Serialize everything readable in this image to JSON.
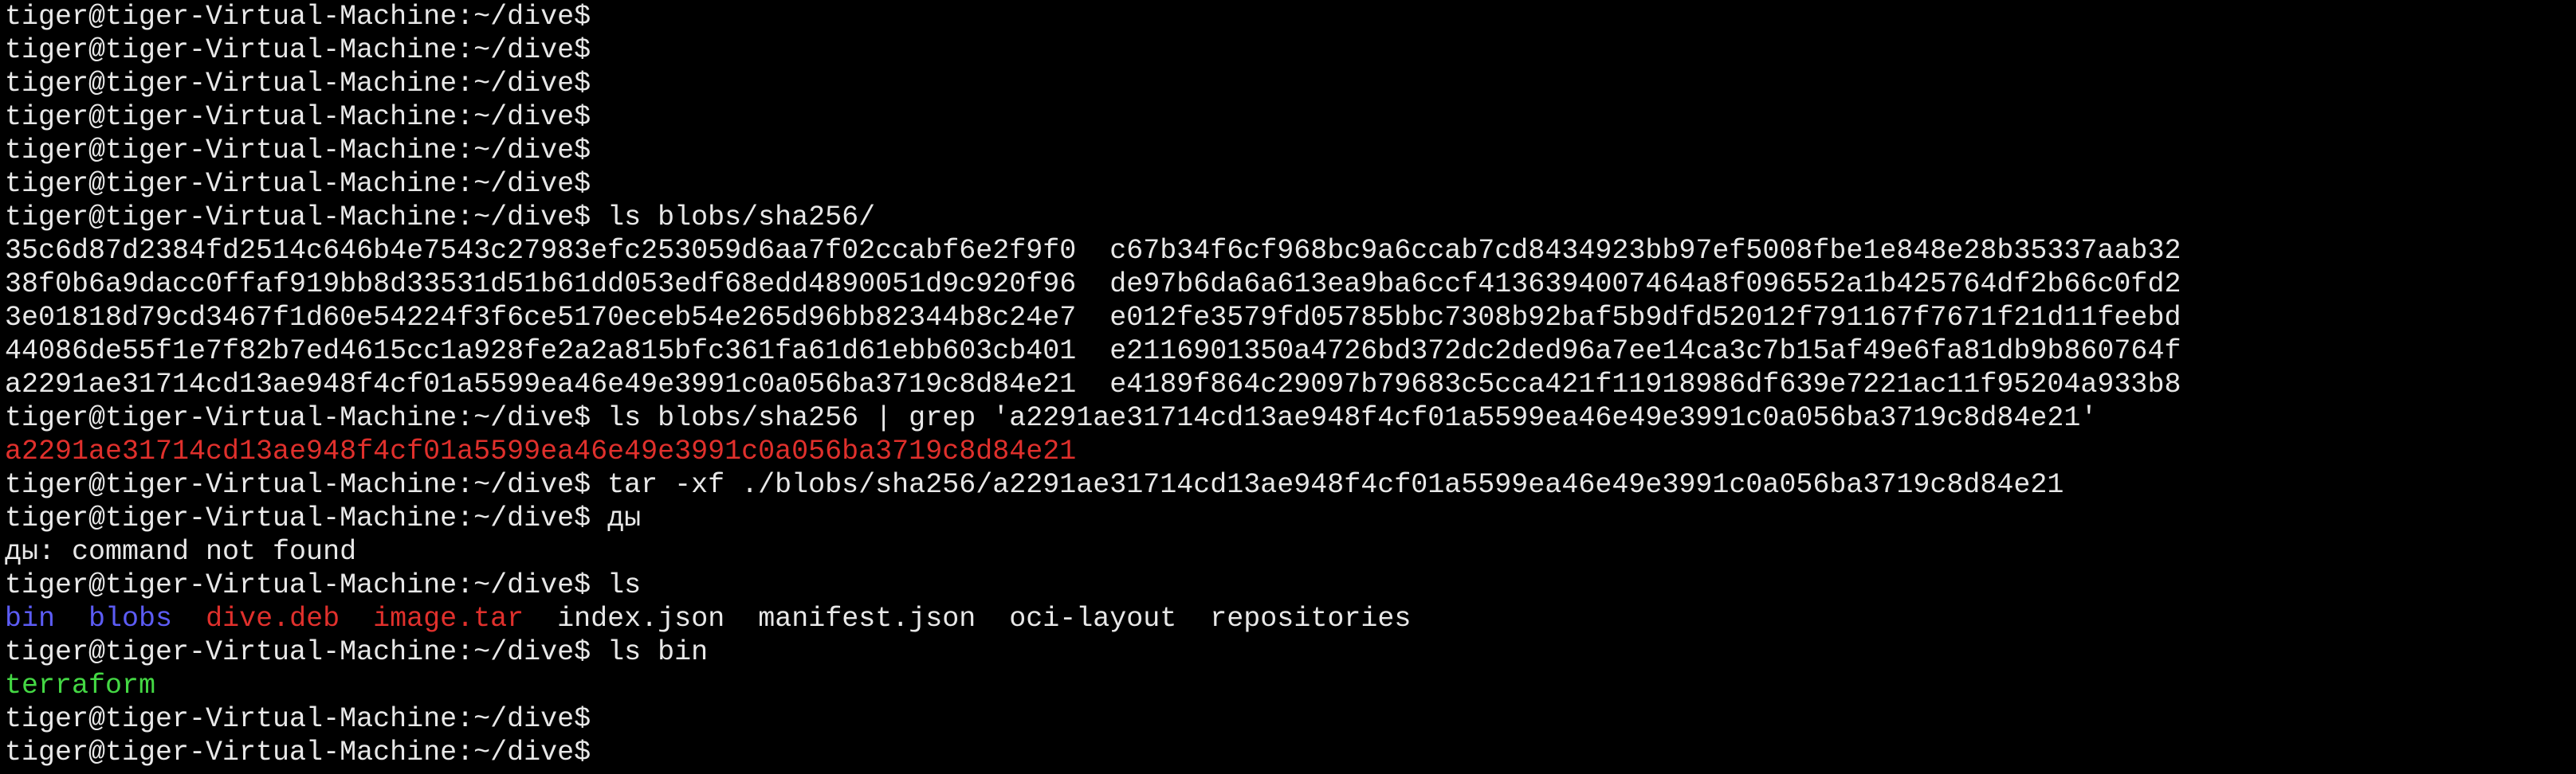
{
  "colors": {
    "background": "#000000",
    "foreground": "#e8e8e8",
    "red": "#e0302c",
    "blue": "#5c5cf5",
    "green": "#44d844"
  },
  "terminal": {
    "lines": [
      [
        {
          "text": "tiger@tiger-Virtual-Machine:~/dive$"
        }
      ],
      [
        {
          "text": "tiger@tiger-Virtual-Machine:~/dive$"
        }
      ],
      [
        {
          "text": "tiger@tiger-Virtual-Machine:~/dive$"
        }
      ],
      [
        {
          "text": "tiger@tiger-Virtual-Machine:~/dive$"
        }
      ],
      [
        {
          "text": "tiger@tiger-Virtual-Machine:~/dive$"
        }
      ],
      [
        {
          "text": "tiger@tiger-Virtual-Machine:~/dive$"
        }
      ],
      [
        {
          "text": "tiger@tiger-Virtual-Machine:~/dive$ ls blobs/sha256/"
        }
      ],
      [
        {
          "text": "35c6d87d2384fd2514c646b4e7543c27983efc253059d6aa7f02ccabf6e2f9f0  c67b34f6cf968bc9a6ccab7cd8434923bb97ef5008fbe1e848e28b35337aab32"
        }
      ],
      [
        {
          "text": "38f0b6a9dacc0ffaf919bb8d33531d51b61dd053edf68edd4890051d9c920f96  de97b6da6a613ea9ba6ccf4136394007464a8f096552a1b425764df2b66c0fd2"
        }
      ],
      [
        {
          "text": "3e01818d79cd3467f1d60e54224f3f6ce5170eceb54e265d96bb82344b8c24e7  e012fe3579fd05785bbc7308b92baf5b9dfd52012f791167f7671f21d11feebd"
        }
      ],
      [
        {
          "text": "44086de55f1e7f82b7ed4615cc1a928fe2a2a815bfc361fa61d61ebb603cb401  e2116901350a4726bd372dc2ded96a7ee14ca3c7b15af49e6fa81db9b860764f"
        }
      ],
      [
        {
          "text": "a2291ae31714cd13ae948f4cf01a5599ea46e49e3991c0a056ba3719c8d84e21  e4189f864c29097b79683c5cca421f11918986df639e7221ac11f95204a933b8"
        }
      ],
      [
        {
          "text": "tiger@tiger-Virtual-Machine:~/dive$ ls blobs/sha256 | grep 'a2291ae31714cd13ae948f4cf01a5599ea46e49e3991c0a056ba3719c8d84e21'"
        }
      ],
      [
        {
          "text": "a2291ae31714cd13ae948f4cf01a5599ea46e49e3991c0a056ba3719c8d84e21",
          "color": "red"
        }
      ],
      [
        {
          "text": "tiger@tiger-Virtual-Machine:~/dive$ tar -xf ./blobs/sha256/a2291ae31714cd13ae948f4cf01a5599ea46e49e3991c0a056ba3719c8d84e21"
        }
      ],
      [
        {
          "text": "tiger@tiger-Virtual-Machine:~/dive$ ды"
        }
      ],
      [
        {
          "text": "ды: command not found"
        }
      ],
      [
        {
          "text": "tiger@tiger-Virtual-Machine:~/dive$ ls"
        }
      ],
      [
        {
          "text": "bin",
          "color": "blue"
        },
        {
          "text": "  "
        },
        {
          "text": "blobs",
          "color": "blue"
        },
        {
          "text": "  "
        },
        {
          "text": "dive.deb",
          "color": "red"
        },
        {
          "text": "  "
        },
        {
          "text": "image.tar",
          "color": "red"
        },
        {
          "text": "  index.json  manifest.json  oci-layout  repositories"
        }
      ],
      [
        {
          "text": "tiger@tiger-Virtual-Machine:~/dive$ ls bin"
        }
      ],
      [
        {
          "text": "terraform",
          "color": "green"
        }
      ],
      [
        {
          "text": "tiger@tiger-Virtual-Machine:~/dive$"
        }
      ],
      [
        {
          "text": "tiger@tiger-Virtual-Machine:~/dive$"
        }
      ]
    ]
  }
}
